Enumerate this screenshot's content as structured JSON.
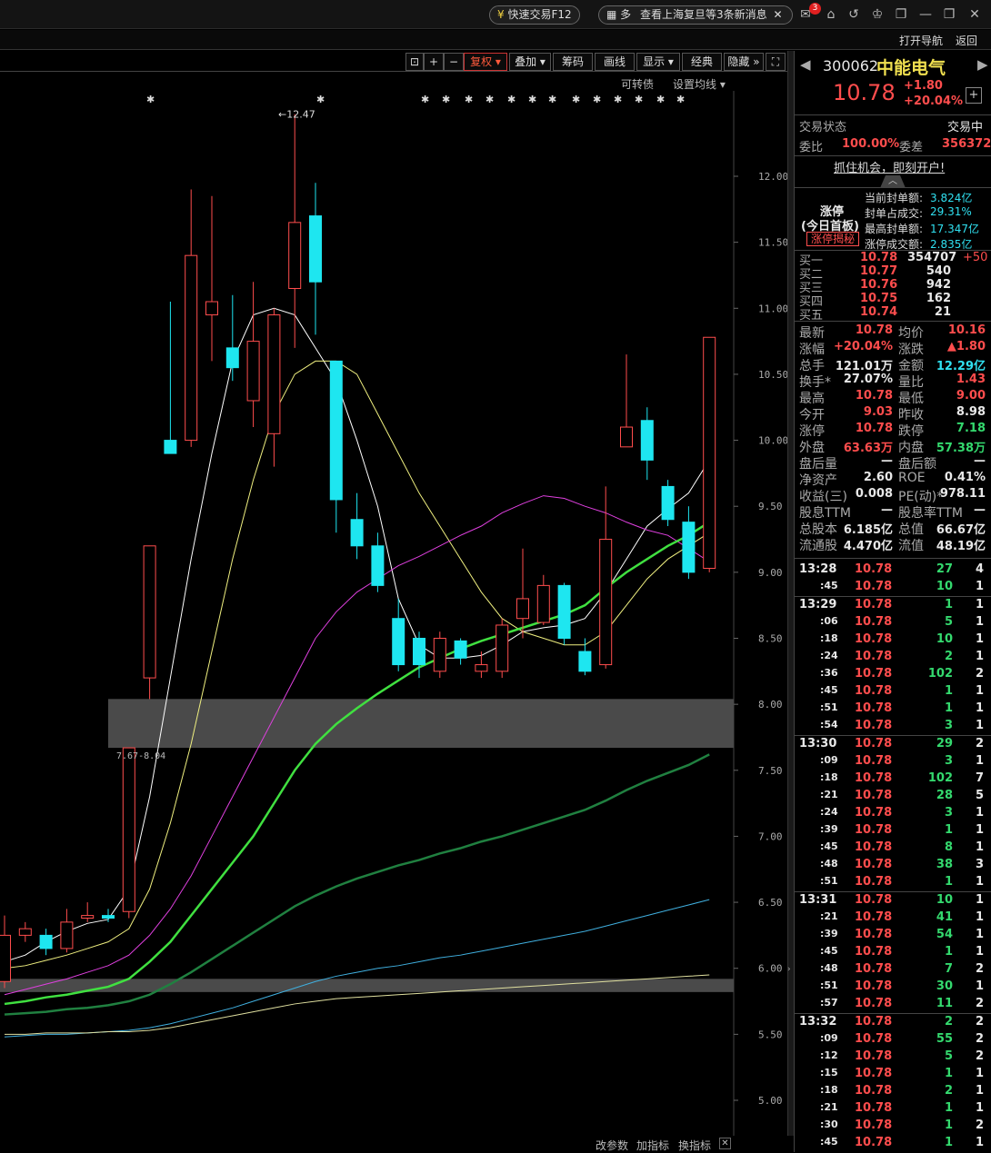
{
  "titlebar": {
    "quick_trade": "快速交易F12",
    "notice_prefix": "多",
    "notice": "查看上海复旦等3条新消息",
    "mail_badge": "3"
  },
  "navbar": {
    "open_nav": "打开导航",
    "back": "返回"
  },
  "toolbar": {
    "buttons": [
      "复权",
      "叠加",
      "筹码",
      "画线",
      "显示",
      "经典",
      "隐藏"
    ],
    "convertible": "可转债",
    "set_ma": "设置均线"
  },
  "stock": {
    "code": "300062",
    "name": "中能电气",
    "price": "10.78",
    "change": "+1.80",
    "change_pct": "+20.04%"
  },
  "status": {
    "trade_state_label": "交易状态",
    "trade_state": "交易中",
    "weibi_label": "委比",
    "weibi": "100.00%",
    "weicha_label": "委差",
    "weicha": "356372",
    "ad": "抓住机会，即刻开户!"
  },
  "limit_up": {
    "title": "涨停",
    "sub": "(今日首板)",
    "reveal": "涨停揭秘",
    "rows": [
      {
        "label": "当前封单额:",
        "value": "3.824亿"
      },
      {
        "label": "封单占成交:",
        "value": "29.31%"
      },
      {
        "label": "最高封单额:",
        "value": "17.347亿"
      },
      {
        "label": "涨停成交额:",
        "value": "2.835亿"
      }
    ]
  },
  "bids": [
    {
      "label": "买一",
      "price": "10.78",
      "vol": "354707",
      "chg": "+50"
    },
    {
      "label": "买二",
      "price": "10.77",
      "vol": "540",
      "chg": ""
    },
    {
      "label": "买三",
      "price": "10.76",
      "vol": "942",
      "chg": ""
    },
    {
      "label": "买四",
      "price": "10.75",
      "vol": "162",
      "chg": ""
    },
    {
      "label": "买五",
      "price": "10.74",
      "vol": "21",
      "chg": ""
    }
  ],
  "quote": [
    {
      "l1": "最新",
      "v1": "10.78",
      "c1": "red",
      "l2": "均价",
      "v2": "10.16",
      "c2": "red"
    },
    {
      "l1": "涨幅",
      "v1": "+20.04%",
      "c1": "red",
      "l2": "涨跌",
      "v2": "▲1.80",
      "c2": "red"
    },
    {
      "l1": "总手",
      "v1": "121.01万",
      "c1": "white",
      "l2": "金额",
      "v2": "12.29亿",
      "c2": "cyan"
    },
    {
      "l1": "换手*",
      "v1": "27.07%",
      "c1": "white",
      "l2": "量比",
      "v2": "1.43",
      "c2": "red"
    },
    {
      "l1": "最高",
      "v1": "10.78",
      "c1": "red",
      "l2": "最低",
      "v2": "9.00",
      "c2": "red"
    },
    {
      "l1": "今开",
      "v1": "9.03",
      "c1": "red",
      "l2": "昨收",
      "v2": "8.98",
      "c2": "white"
    },
    {
      "l1": "涨停",
      "v1": "10.78",
      "c1": "red",
      "l2": "跌停",
      "v2": "7.18",
      "c2": "green"
    },
    {
      "l1": "外盘",
      "v1": "63.63万",
      "c1": "red",
      "l2": "内盘",
      "v2": "57.38万",
      "c2": "green"
    },
    {
      "l1": "盘后量",
      "v1": "—",
      "c1": "white",
      "l2": "盘后额",
      "v2": "—",
      "c2": "white"
    },
    {
      "l1": "净资产",
      "v1": "2.60",
      "c1": "white",
      "l2": "ROE",
      "v2": "0.41%",
      "c2": "white"
    },
    {
      "l1": "收益(三)",
      "v1": "0.008",
      "c1": "white",
      "l2": "PE(动)*",
      "v2": "978.11",
      "c2": "white"
    },
    {
      "l1": "股息TTM",
      "v1": "—",
      "c1": "white",
      "l2": "股息率TTM",
      "v2": "—",
      "c2": "white"
    },
    {
      "l1": "总股本",
      "v1": "6.185亿",
      "c1": "white",
      "l2": "总值",
      "v2": "66.67亿",
      "c2": "white"
    },
    {
      "l1": "流通股",
      "v1": "4.470亿",
      "c1": "white",
      "l2": "流值",
      "v2": "48.19亿",
      "c2": "white"
    }
  ],
  "ticks": [
    {
      "t": "13:28",
      "p": "10.78",
      "v": "27",
      "n": "4",
      "big": true,
      "vc": "green"
    },
    {
      "t": ":45",
      "p": "10.78",
      "v": "10",
      "n": "1",
      "big": false,
      "vc": "green"
    },
    {
      "t": "13:29",
      "p": "10.78",
      "v": "1",
      "n": "1",
      "big": true,
      "vc": "green"
    },
    {
      "t": ":06",
      "p": "10.78",
      "v": "5",
      "n": "1",
      "big": false,
      "vc": "green"
    },
    {
      "t": ":18",
      "p": "10.78",
      "v": "10",
      "n": "1",
      "big": false,
      "vc": "green"
    },
    {
      "t": ":24",
      "p": "10.78",
      "v": "2",
      "n": "1",
      "big": false,
      "vc": "green"
    },
    {
      "t": ":36",
      "p": "10.78",
      "v": "102",
      "n": "2",
      "big": false,
      "vc": "green"
    },
    {
      "t": ":45",
      "p": "10.78",
      "v": "1",
      "n": "1",
      "big": false,
      "vc": "green"
    },
    {
      "t": ":51",
      "p": "10.78",
      "v": "1",
      "n": "1",
      "big": false,
      "vc": "green"
    },
    {
      "t": ":54",
      "p": "10.78",
      "v": "3",
      "n": "1",
      "big": false,
      "vc": "green"
    },
    {
      "t": "13:30",
      "p": "10.78",
      "v": "29",
      "n": "2",
      "big": true,
      "vc": "green"
    },
    {
      "t": ":09",
      "p": "10.78",
      "v": "3",
      "n": "1",
      "big": false,
      "vc": "green"
    },
    {
      "t": ":18",
      "p": "10.78",
      "v": "102",
      "n": "7",
      "big": false,
      "vc": "green"
    },
    {
      "t": ":21",
      "p": "10.78",
      "v": "28",
      "n": "5",
      "big": false,
      "vc": "green"
    },
    {
      "t": ":24",
      "p": "10.78",
      "v": "3",
      "n": "1",
      "big": false,
      "vc": "green"
    },
    {
      "t": ":39",
      "p": "10.78",
      "v": "1",
      "n": "1",
      "big": false,
      "vc": "green"
    },
    {
      "t": ":45",
      "p": "10.78",
      "v": "8",
      "n": "1",
      "big": false,
      "vc": "green"
    },
    {
      "t": ":48",
      "p": "10.78",
      "v": "38",
      "n": "3",
      "big": false,
      "vc": "green"
    },
    {
      "t": ":51",
      "p": "10.78",
      "v": "1",
      "n": "1",
      "big": false,
      "vc": "green"
    },
    {
      "t": "13:31",
      "p": "10.78",
      "v": "10",
      "n": "1",
      "big": true,
      "vc": "green"
    },
    {
      "t": ":21",
      "p": "10.78",
      "v": "41",
      "n": "1",
      "big": false,
      "vc": "green"
    },
    {
      "t": ":39",
      "p": "10.78",
      "v": "54",
      "n": "1",
      "big": false,
      "vc": "green"
    },
    {
      "t": ":45",
      "p": "10.78",
      "v": "1",
      "n": "1",
      "big": false,
      "vc": "green"
    },
    {
      "t": ":48",
      "p": "10.78",
      "v": "7",
      "n": "2",
      "big": false,
      "vc": "green"
    },
    {
      "t": ":51",
      "p": "10.78",
      "v": "30",
      "n": "1",
      "big": false,
      "vc": "green"
    },
    {
      "t": ":57",
      "p": "10.78",
      "v": "11",
      "n": "2",
      "big": false,
      "vc": "green"
    },
    {
      "t": "13:32",
      "p": "10.78",
      "v": "2",
      "n": "2",
      "big": true,
      "vc": "green"
    },
    {
      "t": ":09",
      "p": "10.78",
      "v": "55",
      "n": "2",
      "big": false,
      "vc": "green"
    },
    {
      "t": ":12",
      "p": "10.78",
      "v": "5",
      "n": "2",
      "big": false,
      "vc": "green"
    },
    {
      "t": ":15",
      "p": "10.78",
      "v": "1",
      "n": "1",
      "big": false,
      "vc": "green"
    },
    {
      "t": ":18",
      "p": "10.78",
      "v": "2",
      "n": "1",
      "big": false,
      "vc": "green"
    },
    {
      "t": ":21",
      "p": "10.78",
      "v": "1",
      "n": "1",
      "big": false,
      "vc": "green"
    },
    {
      "t": ":30",
      "p": "10.78",
      "v": "1",
      "n": "2",
      "big": false,
      "vc": "green"
    },
    {
      "t": ":45",
      "p": "10.78",
      "v": "1",
      "n": "1",
      "big": false,
      "vc": "green"
    }
  ],
  "bottom": {
    "modify_params": "改参数",
    "add_indicator": "加指标",
    "change_indicator": "换指标"
  },
  "colors": {
    "up": "#ff4d4d",
    "down": "#1ee6f0",
    "ma5": "#ffffff",
    "ma10": "#f0f080",
    "ma20": "#e040e0",
    "ma30": "#40e040",
    "ma60": "#208040",
    "ma120": "#40b0e0",
    "ma250": "#e0e0a0"
  },
  "chart_data": {
    "type": "candlestick",
    "ylim": [
      4.9,
      12.5
    ],
    "y_ticks": [
      "12.00",
      "11.50",
      "11.00",
      "10.50",
      "10.00",
      "9.50",
      "9.00",
      "8.50",
      "8.00",
      "7.50",
      "7.00",
      "6.50",
      "6.00",
      "5.50",
      "5.00"
    ],
    "annotations": {
      "high": "12.47",
      "gap": "7.67-8.04"
    },
    "gap_zones": [
      [
        7.67,
        8.04
      ],
      [
        5.82,
        5.92
      ]
    ],
    "candles": [
      {
        "o": 5.9,
        "c": 6.25,
        "h": 6.4,
        "l": 5.85
      },
      {
        "o": 6.25,
        "c": 6.3,
        "h": 6.35,
        "l": 6.2
      },
      {
        "o": 6.25,
        "c": 6.15,
        "h": 6.3,
        "l": 6.1
      },
      {
        "o": 6.15,
        "c": 6.35,
        "h": 6.45,
        "l": 6.12
      },
      {
        "o": 6.38,
        "c": 6.4,
        "h": 6.5,
        "l": 6.35
      },
      {
        "o": 6.4,
        "c": 6.38,
        "h": 6.45,
        "l": 6.35
      },
      {
        "o": 6.43,
        "c": 7.67,
        "h": 7.67,
        "l": 6.38
      },
      {
        "o": 8.2,
        "c": 9.2,
        "h": 9.2,
        "l": 8.04
      },
      {
        "o": 10.0,
        "c": 9.9,
        "h": 11.05,
        "l": 9.9
      },
      {
        "o": 10.0,
        "c": 11.4,
        "h": 11.9,
        "l": 9.95
      },
      {
        "o": 10.95,
        "c": 11.05,
        "h": 11.85,
        "l": 10.6
      },
      {
        "o": 10.7,
        "c": 10.55,
        "h": 11.1,
        "l": 10.45
      },
      {
        "o": 10.3,
        "c": 10.75,
        "h": 11.2,
        "l": 10.1
      },
      {
        "o": 10.05,
        "c": 10.95,
        "h": 11.0,
        "l": 9.8
      },
      {
        "o": 11.15,
        "c": 11.65,
        "h": 12.47,
        "l": 10.7
      },
      {
        "o": 11.7,
        "c": 11.2,
        "h": 11.95,
        "l": 10.8
      },
      {
        "o": 10.6,
        "c": 9.55,
        "h": 10.6,
        "l": 9.3
      },
      {
        "o": 9.4,
        "c": 9.2,
        "h": 9.6,
        "l": 9.1
      },
      {
        "o": 9.2,
        "c": 8.9,
        "h": 9.3,
        "l": 8.85
      },
      {
        "o": 8.65,
        "c": 8.3,
        "h": 8.8,
        "l": 8.25
      },
      {
        "o": 8.5,
        "c": 8.3,
        "h": 8.55,
        "l": 8.2
      },
      {
        "o": 8.25,
        "c": 8.5,
        "h": 8.55,
        "l": 8.2
      },
      {
        "o": 8.48,
        "c": 8.35,
        "h": 8.5,
        "l": 8.3
      },
      {
        "o": 8.25,
        "c": 8.3,
        "h": 8.4,
        "l": 8.2
      },
      {
        "o": 8.25,
        "c": 8.6,
        "h": 8.65,
        "l": 8.2
      },
      {
        "o": 8.65,
        "c": 8.8,
        "h": 9.18,
        "l": 8.5
      },
      {
        "o": 8.62,
        "c": 8.9,
        "h": 8.98,
        "l": 8.6
      },
      {
        "o": 8.9,
        "c": 8.5,
        "h": 8.92,
        "l": 8.45
      },
      {
        "o": 8.4,
        "c": 8.25,
        "h": 8.5,
        "l": 8.22
      },
      {
        "o": 8.3,
        "c": 9.25,
        "h": 9.65,
        "l": 8.27
      },
      {
        "o": 9.95,
        "c": 10.1,
        "h": 10.65,
        "l": 9.95
      },
      {
        "o": 10.15,
        "c": 9.85,
        "h": 10.25,
        "l": 9.7
      },
      {
        "o": 9.65,
        "c": 9.4,
        "h": 9.7,
        "l": 9.35
      },
      {
        "o": 9.38,
        "c": 9.0,
        "h": 9.5,
        "l": 8.95
      },
      {
        "o": 9.03,
        "c": 10.78,
        "h": 10.78,
        "l": 9.0
      }
    ],
    "ma": [
      {
        "name": "ma5",
        "values": [
          6.05,
          6.1,
          6.2,
          6.28,
          6.34,
          6.37,
          6.6,
          7.3,
          8.2,
          9.1,
          9.9,
          10.6,
          10.95,
          11.0,
          10.95,
          10.7,
          10.45,
          10.0,
          9.5,
          8.8,
          8.45,
          8.35,
          8.35,
          8.37,
          8.45,
          8.55,
          8.58,
          8.6,
          8.65,
          8.85,
          9.1,
          9.35,
          9.48,
          9.6,
          9.85
        ]
      },
      {
        "name": "ma10",
        "values": [
          6.0,
          6.02,
          6.06,
          6.1,
          6.15,
          6.2,
          6.3,
          6.6,
          7.1,
          7.7,
          8.4,
          9.1,
          9.7,
          10.2,
          10.5,
          10.6,
          10.6,
          10.5,
          10.2,
          9.9,
          9.6,
          9.35,
          9.1,
          8.85,
          8.65,
          8.55,
          8.5,
          8.45,
          8.45,
          8.55,
          8.75,
          8.95,
          9.1,
          9.2,
          9.3
        ]
      },
      {
        "name": "ma20",
        "values": [
          5.8,
          5.84,
          5.88,
          5.92,
          5.97,
          6.02,
          6.1,
          6.25,
          6.45,
          6.7,
          7.0,
          7.3,
          7.6,
          7.9,
          8.2,
          8.5,
          8.7,
          8.85,
          8.95,
          9.05,
          9.12,
          9.2,
          9.28,
          9.35,
          9.45,
          9.52,
          9.58,
          9.56,
          9.5,
          9.45,
          9.38,
          9.32,
          9.28,
          9.18,
          9.08
        ]
      },
      {
        "name": "ma30",
        "values": [
          5.73,
          5.75,
          5.78,
          5.8,
          5.83,
          5.86,
          5.92,
          6.05,
          6.2,
          6.4,
          6.6,
          6.8,
          7.0,
          7.25,
          7.5,
          7.7,
          7.85,
          7.97,
          8.08,
          8.18,
          8.28,
          8.35,
          8.42,
          8.48,
          8.53,
          8.58,
          8.63,
          8.68,
          8.75,
          8.88,
          9.0,
          9.1,
          9.2,
          9.28,
          9.38
        ]
      },
      {
        "name": "ma60",
        "values": [
          5.65,
          5.66,
          5.67,
          5.69,
          5.7,
          5.72,
          5.75,
          5.8,
          5.88,
          5.97,
          6.07,
          6.17,
          6.27,
          6.37,
          6.47,
          6.55,
          6.62,
          6.68,
          6.73,
          6.78,
          6.82,
          6.87,
          6.91,
          6.96,
          7.0,
          7.05,
          7.1,
          7.15,
          7.2,
          7.27,
          7.35,
          7.42,
          7.48,
          7.54,
          7.62
        ]
      },
      {
        "name": "ma120",
        "values": [
          5.48,
          5.49,
          5.5,
          5.5,
          5.51,
          5.52,
          5.53,
          5.55,
          5.58,
          5.62,
          5.66,
          5.7,
          5.75,
          5.8,
          5.85,
          5.9,
          5.94,
          5.97,
          6.0,
          6.02,
          6.05,
          6.08,
          6.1,
          6.13,
          6.16,
          6.19,
          6.22,
          6.25,
          6.28,
          6.32,
          6.36,
          6.4,
          6.44,
          6.48,
          6.52
        ]
      },
      {
        "name": "ma250",
        "values": [
          5.5,
          5.5,
          5.51,
          5.51,
          5.51,
          5.52,
          5.52,
          5.53,
          5.55,
          5.58,
          5.61,
          5.64,
          5.67,
          5.7,
          5.73,
          5.75,
          5.77,
          5.78,
          5.79,
          5.8,
          5.81,
          5.82,
          5.83,
          5.84,
          5.85,
          5.86,
          5.87,
          5.88,
          5.89,
          5.9,
          5.91,
          5.92,
          5.93,
          5.94,
          5.95
        ]
      }
    ]
  }
}
